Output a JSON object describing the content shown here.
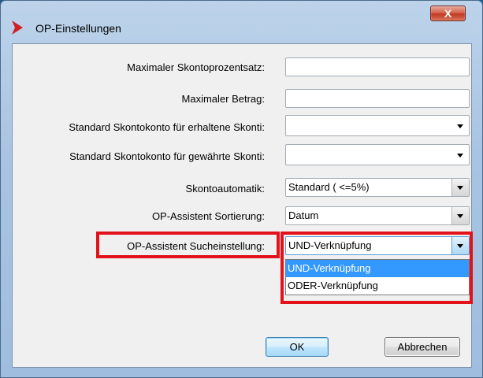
{
  "window": {
    "title": "OP-Einstellungen",
    "close_label": "X"
  },
  "form": {
    "max_skonto_label": "Maximaler Skontoprozentsatz:",
    "max_skonto_value": "",
    "max_betrag_label": "Maximaler Betrag:",
    "max_betrag_value": "",
    "skonto_erhalten_label": "Standard Skontokonto für erhaltene Skonti:",
    "skonto_erhalten_value": "",
    "skonto_gewaehrt_label": "Standard Skontokonto für gewährte Skonti:",
    "skonto_gewaehrt_value": "",
    "skontoautomatik_label": "Skontoautomatik:",
    "skontoautomatik_value": "Standard ( <=5%)",
    "sortierung_label": "OP-Assistent Sortierung:",
    "sortierung_value": "Datum",
    "sucheinstellung_label": "OP-Assistent Sucheinstellung:",
    "sucheinstellung_value": "UND-Verknüpfung"
  },
  "dropdown": {
    "options": [
      "UND-Verknüpfung",
      "ODER-Verknüpfung"
    ],
    "selected": "UND-Verknüpfung"
  },
  "buttons": {
    "ok_label": "OK",
    "cancel_label": "Abbrechen"
  },
  "colors": {
    "highlight": "#e2121b",
    "selection": "#3399ff",
    "logo": "#d21f26"
  },
  "icons": {
    "logo": "red-chevron-icon",
    "dropdown": "chevron-down-icon"
  }
}
